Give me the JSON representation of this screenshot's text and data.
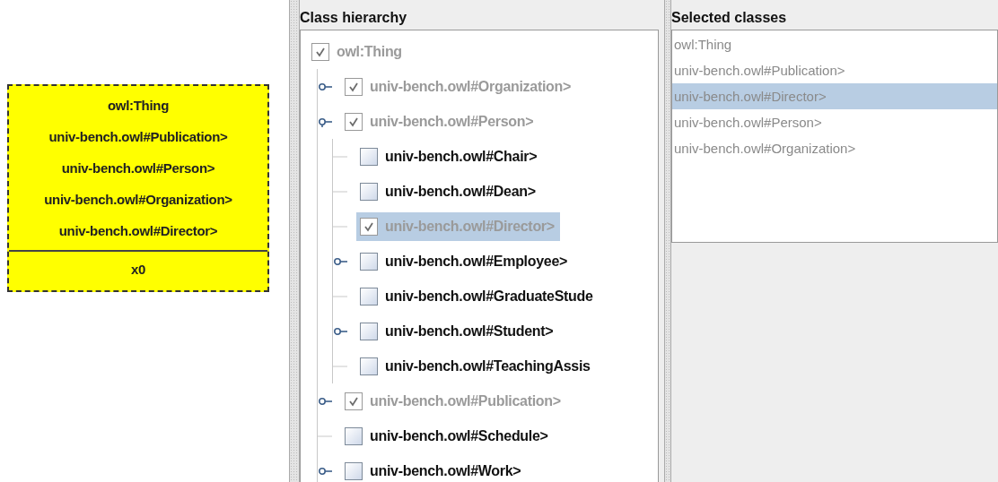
{
  "node_box": {
    "classes": [
      "owl:Thing",
      "univ-bench.owl#Publication>",
      "univ-bench.owl#Person>",
      "univ-bench.owl#Organization>",
      "univ-bench.owl#Director>"
    ],
    "variable": "x0"
  },
  "class_hierarchy": {
    "title": "Class hierarchy",
    "tree": [
      {
        "label": "owl:Thing",
        "checked": true,
        "selected": false,
        "children": [
          {
            "label": "univ-bench.owl#Organization>",
            "checked": true,
            "selected": false,
            "expanded": false
          },
          {
            "label": "univ-bench.owl#Person>",
            "checked": true,
            "selected": false,
            "expanded": true,
            "children": [
              {
                "label": "univ-bench.owl#Chair>",
                "checked": false,
                "selected": false
              },
              {
                "label": "univ-bench.owl#Dean>",
                "checked": false,
                "selected": false
              },
              {
                "label": "univ-bench.owl#Director>",
                "checked": true,
                "selected": true
              },
              {
                "label": "univ-bench.owl#Employee>",
                "checked": false,
                "selected": false,
                "expanded": false
              },
              {
                "label": "univ-bench.owl#GraduateStude",
                "checked": false,
                "selected": false
              },
              {
                "label": "univ-bench.owl#Student>",
                "checked": false,
                "selected": false,
                "expanded": false
              },
              {
                "label": "univ-bench.owl#TeachingAssis",
                "checked": false,
                "selected": false
              }
            ]
          },
          {
            "label": "univ-bench.owl#Publication>",
            "checked": true,
            "selected": false,
            "expanded": false
          },
          {
            "label": "univ-bench.owl#Schedule>",
            "checked": false,
            "selected": false
          },
          {
            "label": "univ-bench.owl#Work>",
            "checked": false,
            "selected": false,
            "expanded": false
          }
        ]
      }
    ]
  },
  "selected_classes": {
    "title": "Selected classes",
    "items": [
      {
        "label": "owl:Thing",
        "selected": false
      },
      {
        "label": "univ-bench.owl#Publication>",
        "selected": false
      },
      {
        "label": "univ-bench.owl#Director>",
        "selected": true
      },
      {
        "label": "univ-bench.owl#Person>",
        "selected": false
      },
      {
        "label": "univ-bench.owl#Organization>",
        "selected": false
      }
    ]
  }
}
